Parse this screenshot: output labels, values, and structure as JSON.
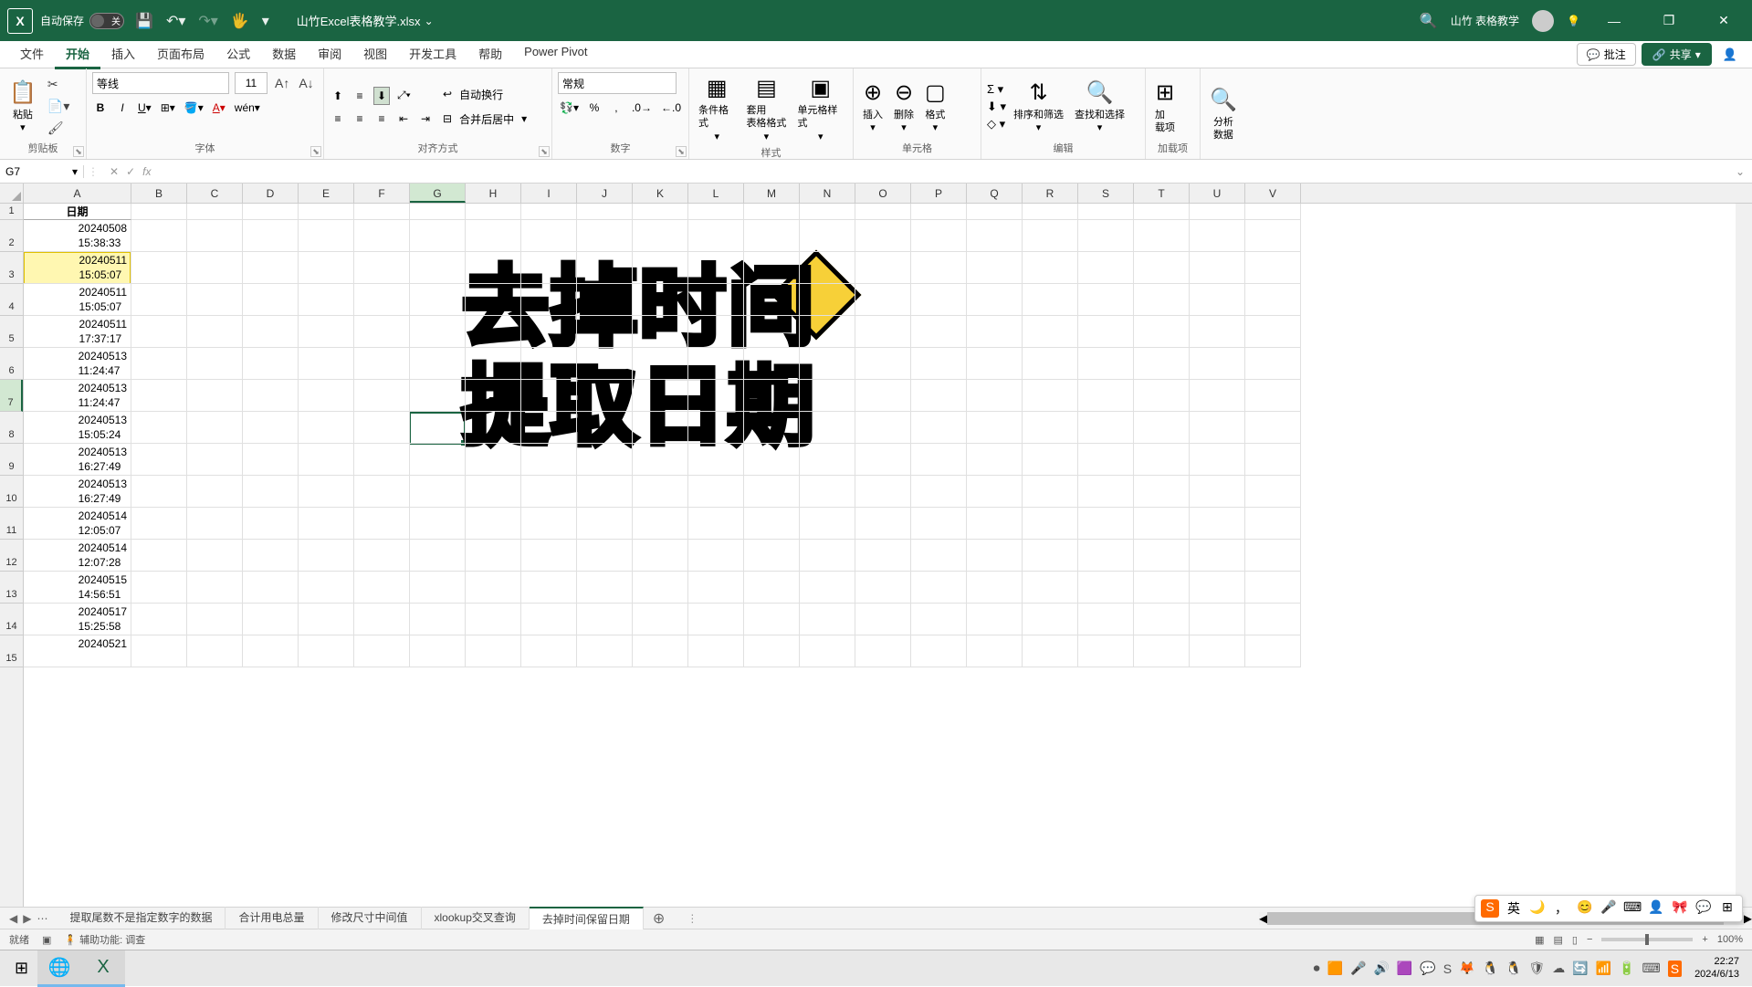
{
  "titlebar": {
    "autosave_label": "自动保存",
    "autosave_state": "关",
    "filename": "山竹Excel表格教学.xlsx",
    "username": "山竹 表格教学"
  },
  "tabs": {
    "items": [
      "文件",
      "开始",
      "插入",
      "页面布局",
      "公式",
      "数据",
      "审阅",
      "视图",
      "开发工具",
      "帮助",
      "Power Pivot"
    ],
    "active": "开始",
    "comments": "批注",
    "share": "共享"
  },
  "ribbon": {
    "clipboard": {
      "label": "剪贴板",
      "paste": "粘贴"
    },
    "font": {
      "label": "字体",
      "name": "等线",
      "size": "11"
    },
    "align": {
      "label": "对齐方式",
      "wrap": "自动换行",
      "merge": "合并后居中"
    },
    "number": {
      "label": "数字",
      "format": "常规"
    },
    "styles": {
      "label": "样式",
      "cond": "条件格式",
      "table": "套用\n表格格式",
      "cell": "单元格样式"
    },
    "cells": {
      "label": "单元格",
      "insert": "插入",
      "delete": "删除",
      "format": "格式"
    },
    "editing": {
      "label": "编辑",
      "sort": "排序和筛选",
      "find": "查找和选择"
    },
    "addins": {
      "label": "加载项",
      "add": "加\n载项"
    },
    "analyze": {
      "label": "",
      "analyze": "分析\n数据"
    }
  },
  "namebox": {
    "ref": "G7",
    "fx": "fx"
  },
  "columns": [
    "A",
    "B",
    "C",
    "D",
    "E",
    "F",
    "G",
    "H",
    "I",
    "J",
    "K",
    "L",
    "M",
    "N",
    "O",
    "P",
    "Q",
    "R",
    "S",
    "T",
    "U",
    "V"
  ],
  "col_widths": {
    "A": 118,
    "default": 61
  },
  "selected_col": "G",
  "selected_row": 7,
  "header_cell": "日期",
  "data_rows": [
    {
      "l1": "20240508",
      "l2": "15:38:33"
    },
    {
      "l1": "20240511",
      "l2": "15:05:07"
    },
    {
      "l1": "20240511",
      "l2": "15:05:07"
    },
    {
      "l1": "20240511",
      "l2": "17:37:17"
    },
    {
      "l1": "20240513",
      "l2": "11:24:47"
    },
    {
      "l1": "20240513",
      "l2": "11:24:47"
    },
    {
      "l1": "20240513",
      "l2": "15:05:24"
    },
    {
      "l1": "20240513",
      "l2": "16:27:49"
    },
    {
      "l1": "20240513",
      "l2": "16:27:49"
    },
    {
      "l1": "20240514",
      "l2": "12:05:07"
    },
    {
      "l1": "20240514",
      "l2": "12:07:28"
    },
    {
      "l1": "20240515",
      "l2": "14:56:51"
    },
    {
      "l1": "20240517",
      "l2": "15:25:58"
    },
    {
      "l1": "20240521",
      "l2": ""
    }
  ],
  "overlay": {
    "line1": "去掉时间",
    "line2": "提取日期"
  },
  "sheets": {
    "items": [
      "提取尾数不是指定数字的数据",
      "合计用电总量",
      "修改尺寸中间值",
      "xlookup交叉查询",
      "去掉时间保留日期"
    ],
    "active": "去掉时间保留日期"
  },
  "statusbar": {
    "ready": "就绪",
    "access": "辅助功能: 调查",
    "zoom": "100%"
  },
  "clock": {
    "time": "22:27",
    "date": "2024/6/13"
  },
  "ime_lang": "英"
}
